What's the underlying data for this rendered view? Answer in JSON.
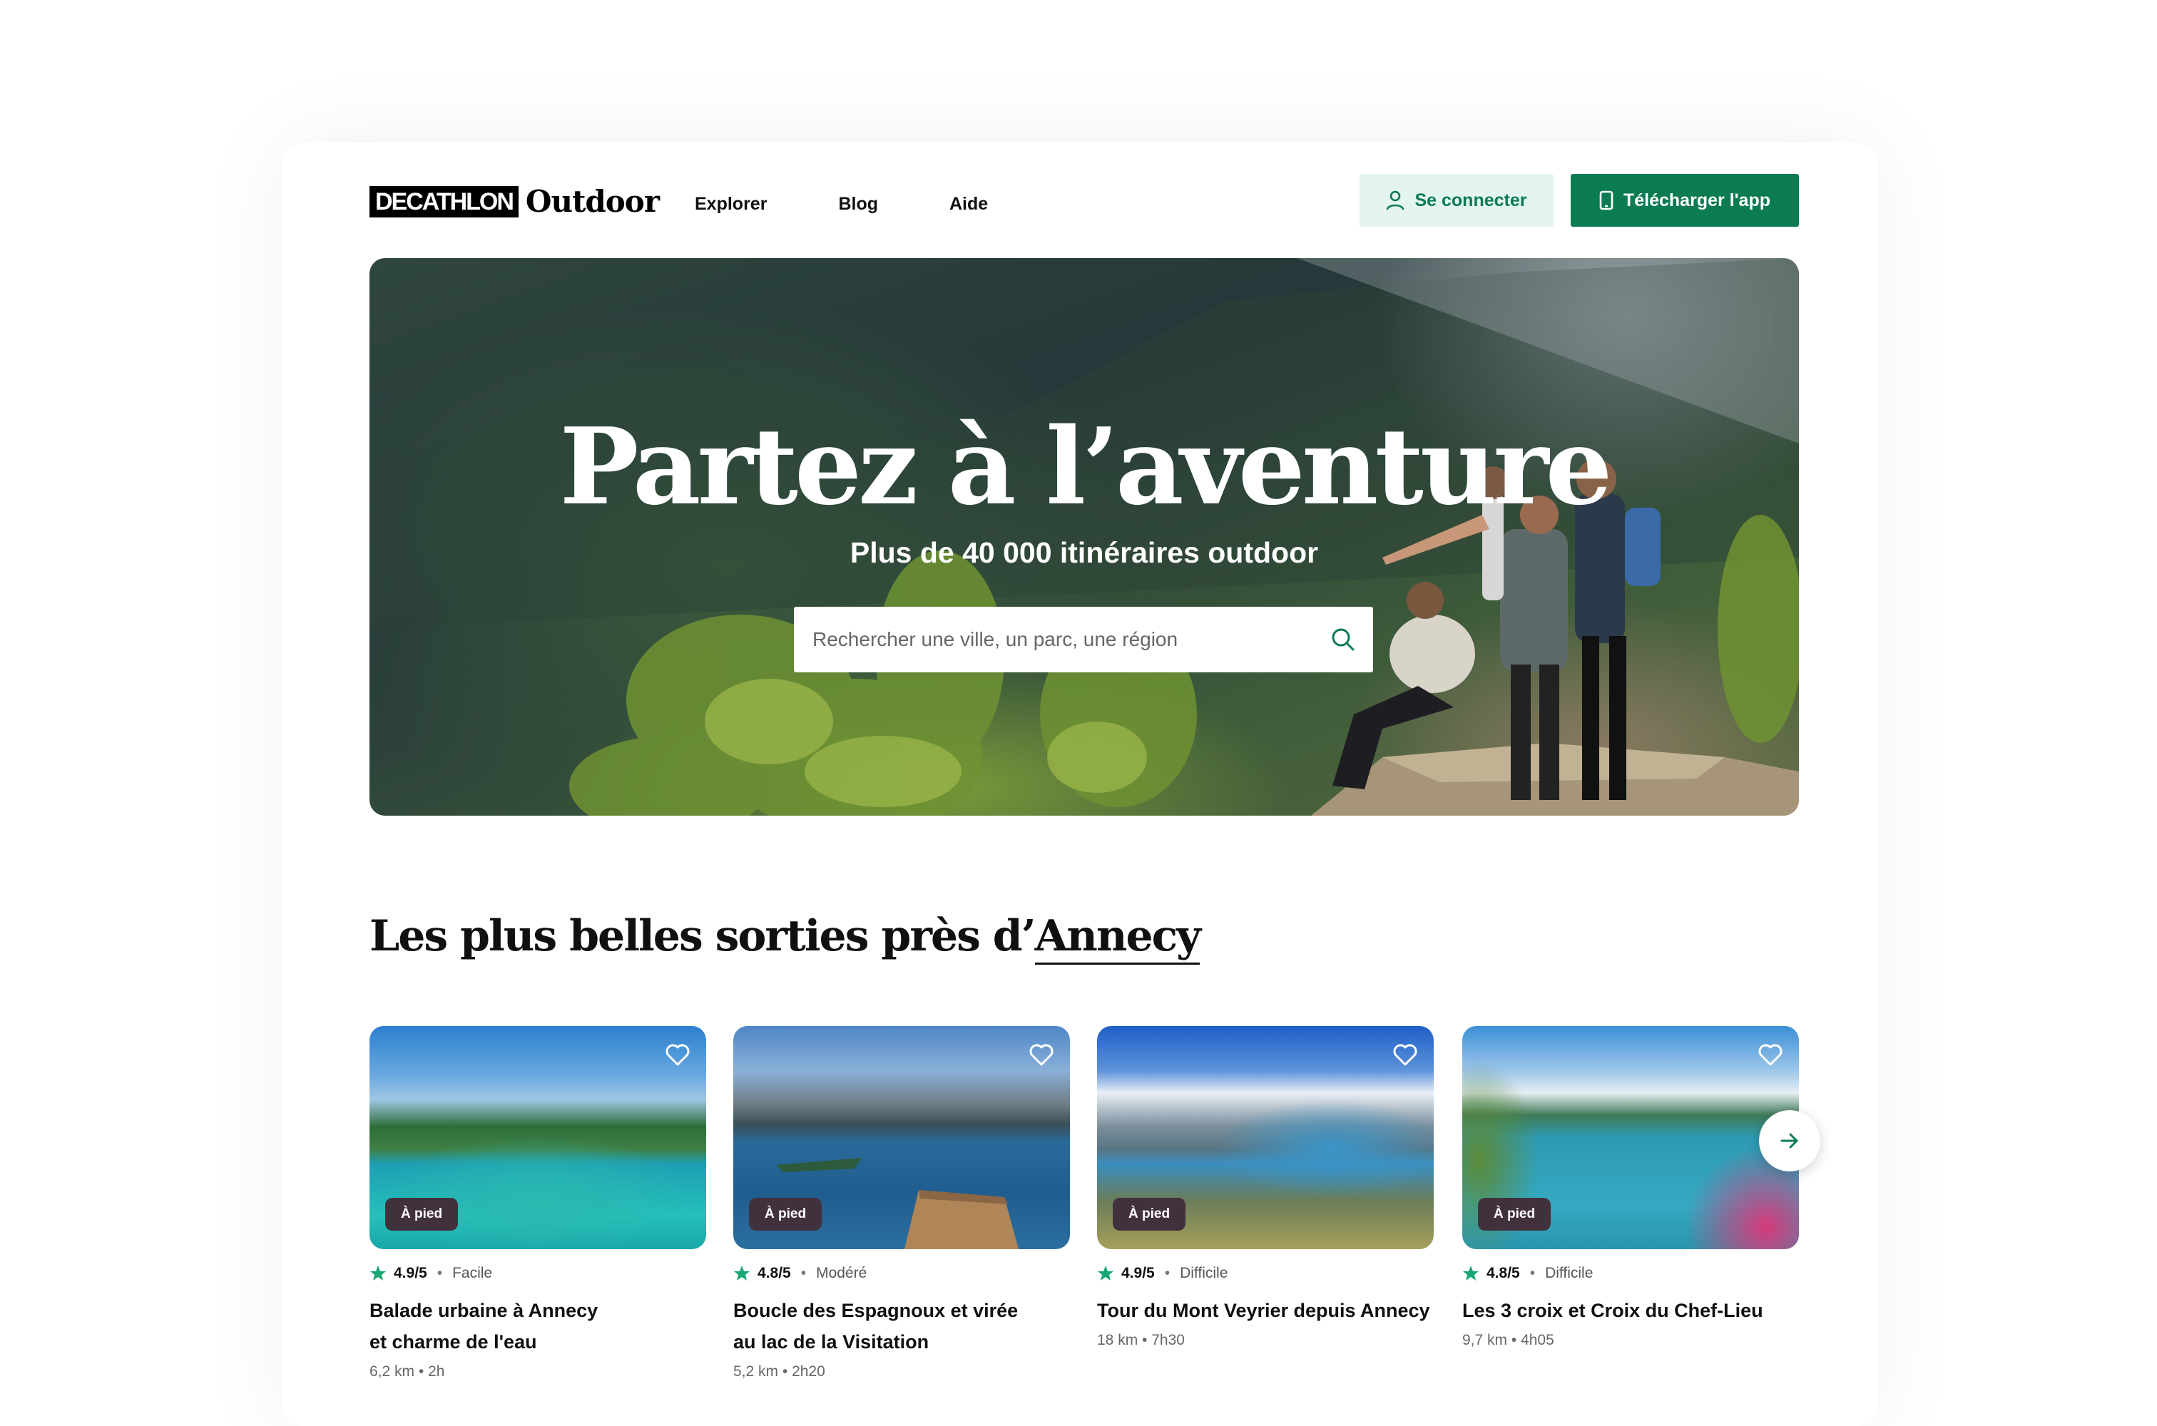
{
  "header": {
    "brand": "DECATHLON",
    "product": "Outdoor",
    "nav": [
      "Explorer",
      "Blog",
      "Aide"
    ],
    "login_label": "Se connecter",
    "app_label": "Télécharger l'app"
  },
  "hero": {
    "title": "Partez à l’aventure",
    "subtitle": "Plus de 40 000 itinéraires outdoor",
    "search_placeholder": "Rechercher une ville, un parc, une région"
  },
  "section": {
    "title_prefix": "Les plus belles sorties près d’",
    "city": "Annecy"
  },
  "routes": [
    {
      "badge": "À pied",
      "rating": "4.9/5",
      "difficulty": "Facile",
      "name_line1": "Balade urbaine à Annecy",
      "name_line2": "et charme de l'eau",
      "distance": "6,2 km",
      "duration": "2h"
    },
    {
      "badge": "À pied",
      "rating": "4.8/5",
      "difficulty": "Modéré",
      "name_line1": "Boucle des Espagnoux et virée",
      "name_line2": "au lac de la Visitation",
      "distance": "5,2 km",
      "duration": "2h20"
    },
    {
      "badge": "À pied",
      "rating": "4.9/5",
      "difficulty": "Difficile",
      "name_line1": "Tour du Mont Veyrier depuis Annecy",
      "name_line2": "",
      "distance": "18 km",
      "duration": "7h30"
    },
    {
      "badge": "À pied",
      "rating": "4.8/5",
      "difficulty": "Difficile",
      "name_line1": "Les 3 croix et Croix du Chef-Lieu",
      "name_line2": "",
      "distance": "9,7 km",
      "duration": "4h05"
    }
  ],
  "colors": {
    "accent": "#0b7b52",
    "accent_light": "#e4f4ef",
    "badge": "#41313c",
    "star": "#19a774"
  },
  "icons": {
    "login": "user-icon",
    "app": "phone-icon",
    "search": "search-icon",
    "favorite": "heart-icon",
    "rating": "star-icon",
    "next": "arrow-right-icon"
  }
}
